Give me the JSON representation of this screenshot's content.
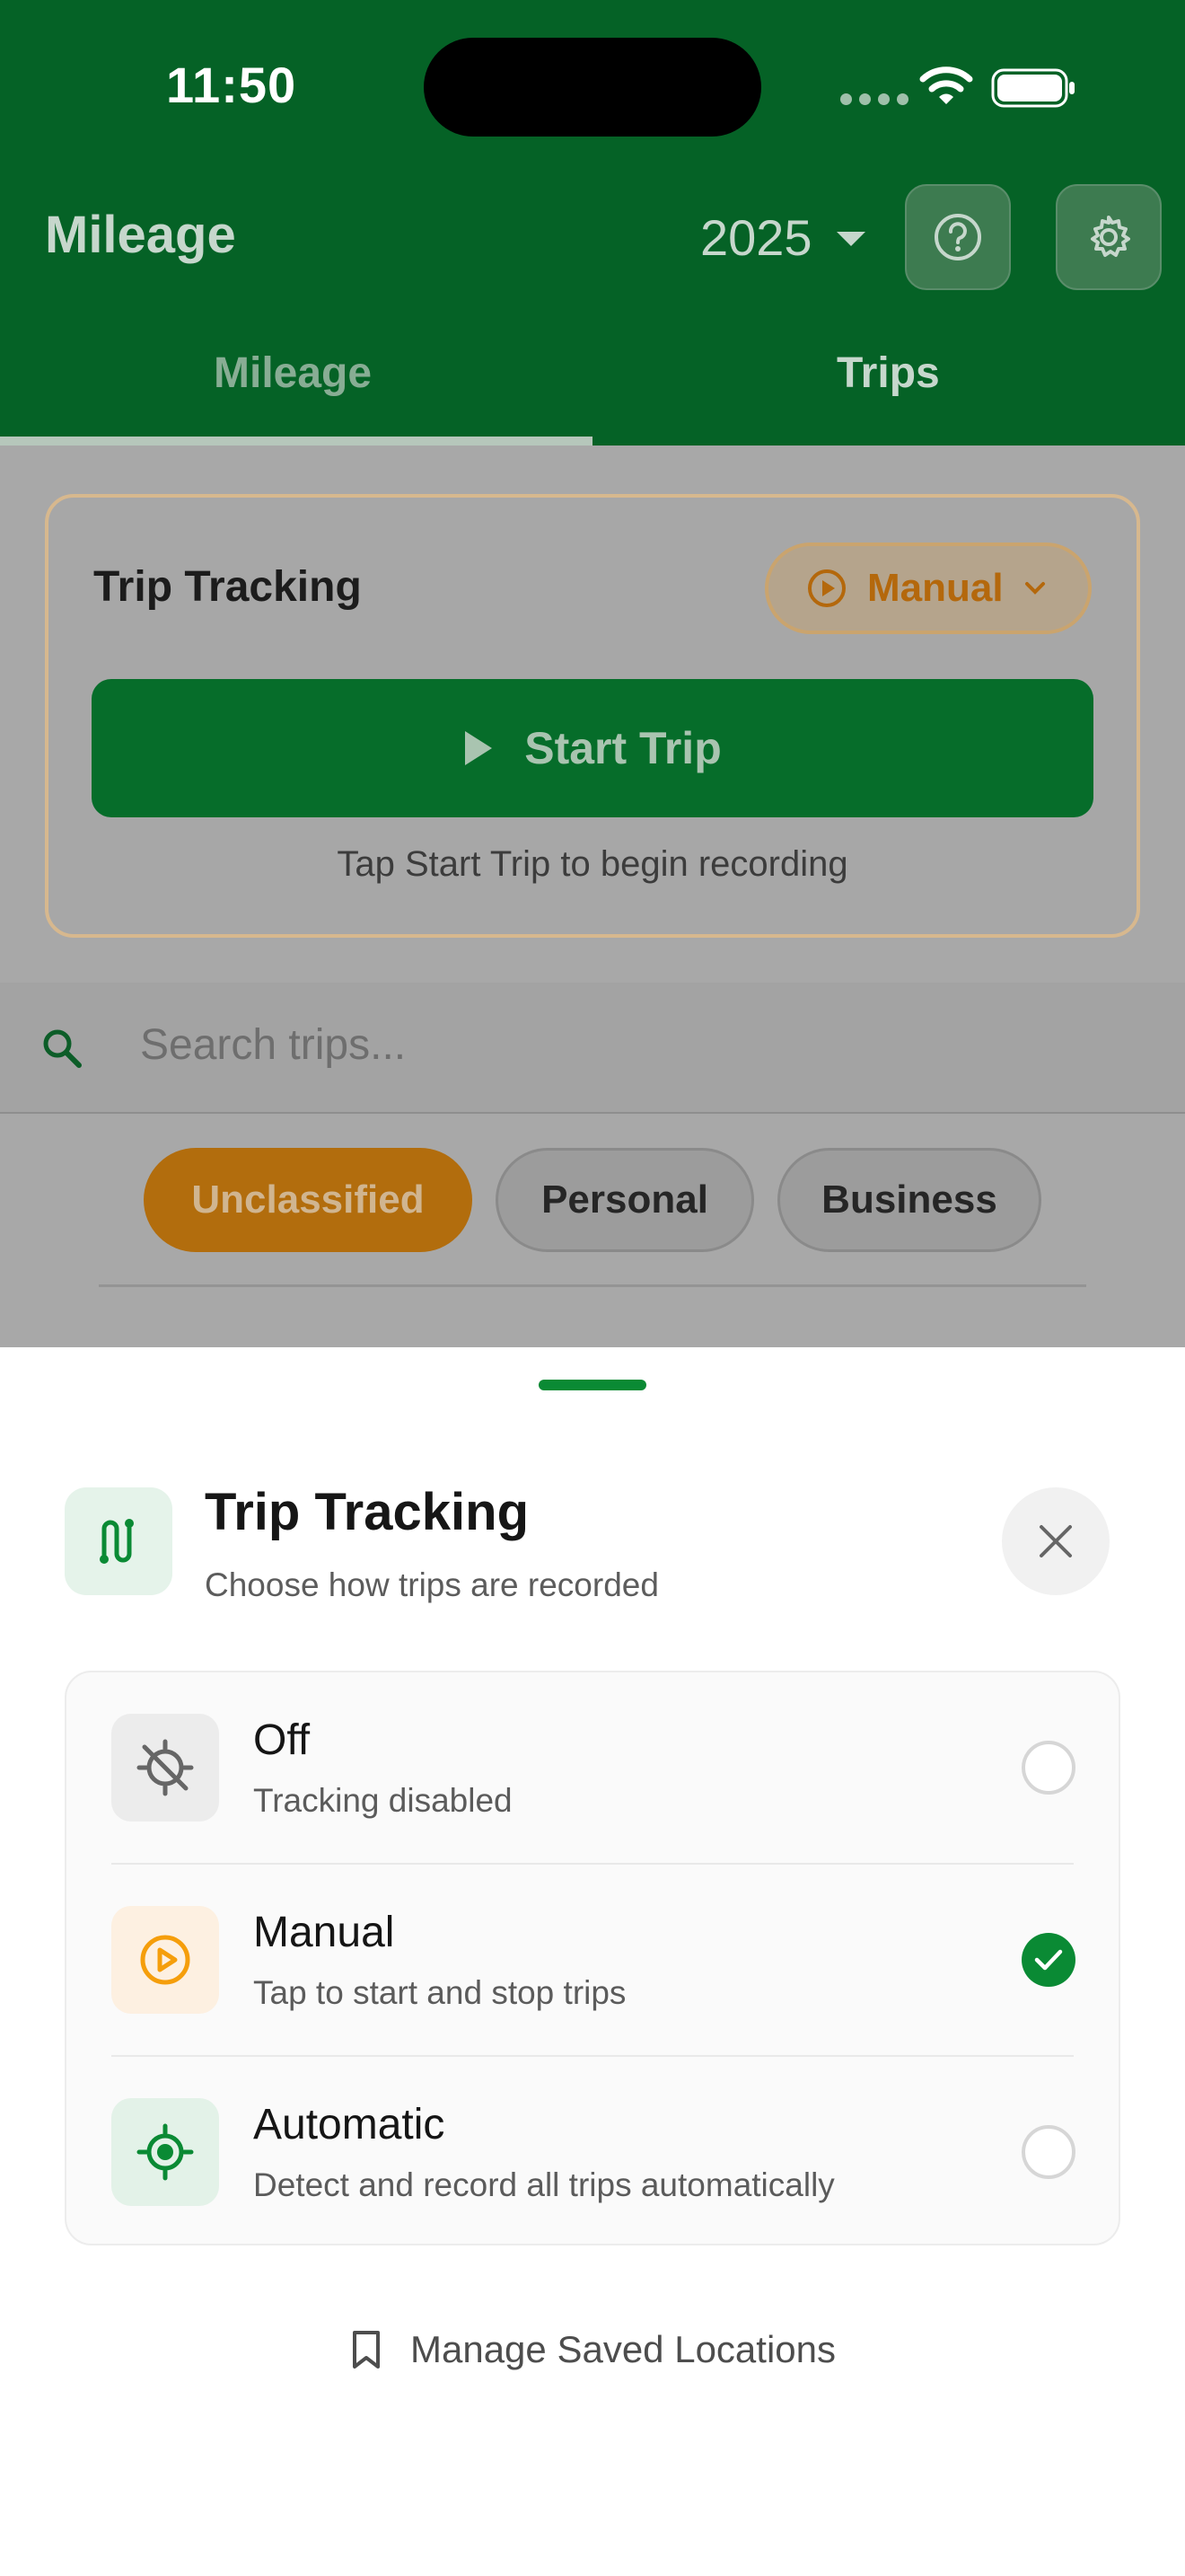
{
  "status_bar": {
    "time": "11:50"
  },
  "header": {
    "title": "Mileage",
    "year": "2025",
    "help_icon": "help-circle-icon",
    "settings_icon": "gear-icon",
    "tabs": [
      {
        "label": "Mileage"
      },
      {
        "label": "Trips"
      }
    ]
  },
  "tracking_card": {
    "title": "Trip Tracking",
    "mode_label": "Manual",
    "start_label": "Start Trip",
    "hint": "Tap Start Trip to begin recording"
  },
  "search": {
    "placeholder": "Search trips..."
  },
  "filters": [
    {
      "label": "Unclassified"
    },
    {
      "label": "Personal"
    },
    {
      "label": "Business"
    }
  ],
  "sheet": {
    "title": "Trip Tracking",
    "subtitle": "Choose how trips are recorded",
    "options": [
      {
        "title": "Off",
        "description": "Tracking disabled",
        "icon": "location-off-icon",
        "selected": false
      },
      {
        "title": "Manual",
        "description": "Tap to start and stop trips",
        "icon": "play-circle-icon",
        "selected": true
      },
      {
        "title": "Automatic",
        "description": "Detect and record all trips automatically",
        "icon": "gps-target-icon",
        "selected": false
      }
    ],
    "manage_label": "Manage Saved Locations"
  },
  "colors": {
    "brand_green": "#056226",
    "accent_green": "#0a8a34",
    "accent_orange": "#f59e0b"
  }
}
